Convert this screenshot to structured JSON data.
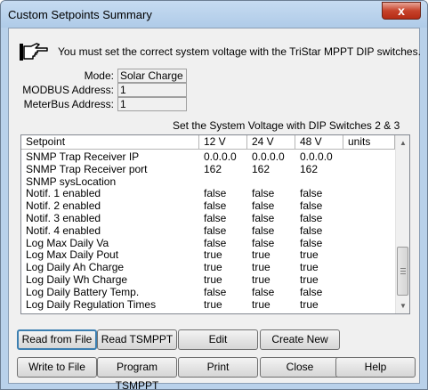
{
  "window": {
    "title": "Custom Setpoints Summary",
    "close_glyph": "x"
  },
  "warning_text": "You must set the correct system voltage with the TriStar MPPT DIP switches.",
  "icons": {
    "hand": "pointing-hand-icon",
    "close": "close-icon"
  },
  "fields": {
    "mode": {
      "label": "Mode:",
      "value": "Solar Charge"
    },
    "modbus": {
      "label": "MODBUS Address:",
      "value": "1"
    },
    "meterbus": {
      "label": "MeterBus Address:",
      "value": "1"
    }
  },
  "dip_note": "Set the System Voltage with DIP Switches 2 & 3",
  "table": {
    "columns": [
      "Setpoint",
      "12 V",
      "24 V",
      "48 V",
      "units"
    ],
    "rows": [
      [
        "SNMP Trap Receiver IP",
        "0.0.0.0",
        "0.0.0.0",
        "0.0.0.0",
        ""
      ],
      [
        "SNMP Trap Receiver port",
        "162",
        "162",
        "162",
        ""
      ],
      [
        "SNMP sysLocation",
        "",
        "",
        "",
        ""
      ],
      [
        "Notif. 1 enabled",
        "false",
        "false",
        "false",
        ""
      ],
      [
        "Notif. 2 enabled",
        "false",
        "false",
        "false",
        ""
      ],
      [
        "Notif. 3 enabled",
        "false",
        "false",
        "false",
        ""
      ],
      [
        "Notif. 4 enabled",
        "false",
        "false",
        "false",
        ""
      ],
      [
        "Log Max Daily Va",
        "false",
        "false",
        "false",
        ""
      ],
      [
        "Log Max Daily Pout",
        "true",
        "true",
        "true",
        ""
      ],
      [
        "Log Daily Ah Charge",
        "true",
        "true",
        "true",
        ""
      ],
      [
        "Log Daily Wh Charge",
        "true",
        "true",
        "true",
        ""
      ],
      [
        "Log Daily Battery Temp.",
        "false",
        "false",
        "false",
        ""
      ],
      [
        "Log Daily Regulation Times",
        "true",
        "true",
        "true",
        ""
      ]
    ]
  },
  "buttons": {
    "row1": [
      "Read from File",
      "Read TSMPPT",
      "Edit",
      "Create New"
    ],
    "row2": [
      "Write to File",
      "Program TSMPPT",
      "Print",
      "Close",
      "Help"
    ]
  }
}
